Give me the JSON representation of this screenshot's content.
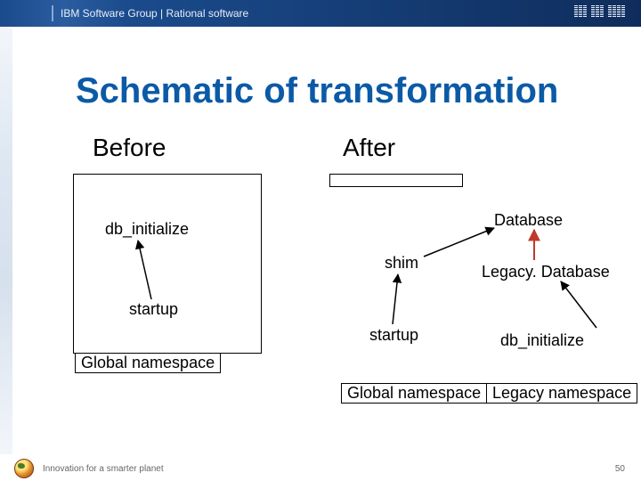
{
  "header": {
    "group_label": "IBM Software Group | Rational software"
  },
  "title": "Schematic of transformation",
  "sections": {
    "before": "Before",
    "after": "After"
  },
  "before": {
    "db_initialize": "db_initialize",
    "startup": "startup",
    "global_namespace": "Global namespace"
  },
  "after": {
    "database": "Database",
    "shim": "shim",
    "legacy_database": "Legacy. Database",
    "startup": "startup",
    "db_initialize": "db_initialize",
    "global_namespace": "Global namespace",
    "legacy_namespace": "Legacy namespace"
  },
  "footer": {
    "tagline": "Innovation for a smarter planet",
    "page": "50"
  }
}
